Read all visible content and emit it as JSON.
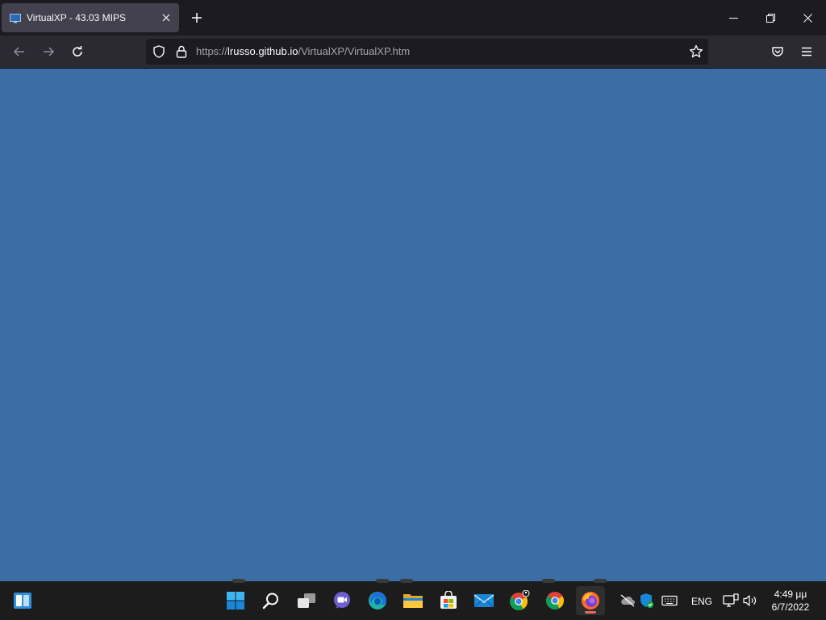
{
  "browser": {
    "tab": {
      "title": "VirtualXP - 43.03 MIPS",
      "favicon": "computer-monitor-icon"
    },
    "url": {
      "scheme": "https://",
      "domain": "lrusso.github.io",
      "path": "/VirtualXP/VirtualXP.htm"
    },
    "colors": {
      "tabbar": "#1c1b22",
      "toolbar": "#2b2a33",
      "urlbar": "#1c1b22",
      "active_tab": "#42414d"
    }
  },
  "page": {
    "background_color": "#3a6ea5"
  },
  "taskbar": {
    "apps": [
      {
        "name": "widgets",
        "icon": "widgets-icon"
      },
      {
        "name": "start",
        "icon": "windows-logo-icon"
      },
      {
        "name": "search",
        "icon": "search-icon"
      },
      {
        "name": "task-view",
        "icon": "task-view-icon"
      },
      {
        "name": "chat",
        "icon": "teams-chat-icon"
      },
      {
        "name": "edge",
        "icon": "edge-icon"
      },
      {
        "name": "file-explorer",
        "icon": "folder-icon"
      },
      {
        "name": "store",
        "icon": "store-icon"
      },
      {
        "name": "mail",
        "icon": "mail-icon"
      },
      {
        "name": "chrome-profile",
        "icon": "chrome-profile-icon"
      },
      {
        "name": "chrome",
        "icon": "chrome-icon"
      },
      {
        "name": "firefox",
        "icon": "firefox-icon"
      }
    ],
    "tray": {
      "language": "ENG",
      "time": "4:49 μμ",
      "date": "6/7/2022"
    }
  }
}
